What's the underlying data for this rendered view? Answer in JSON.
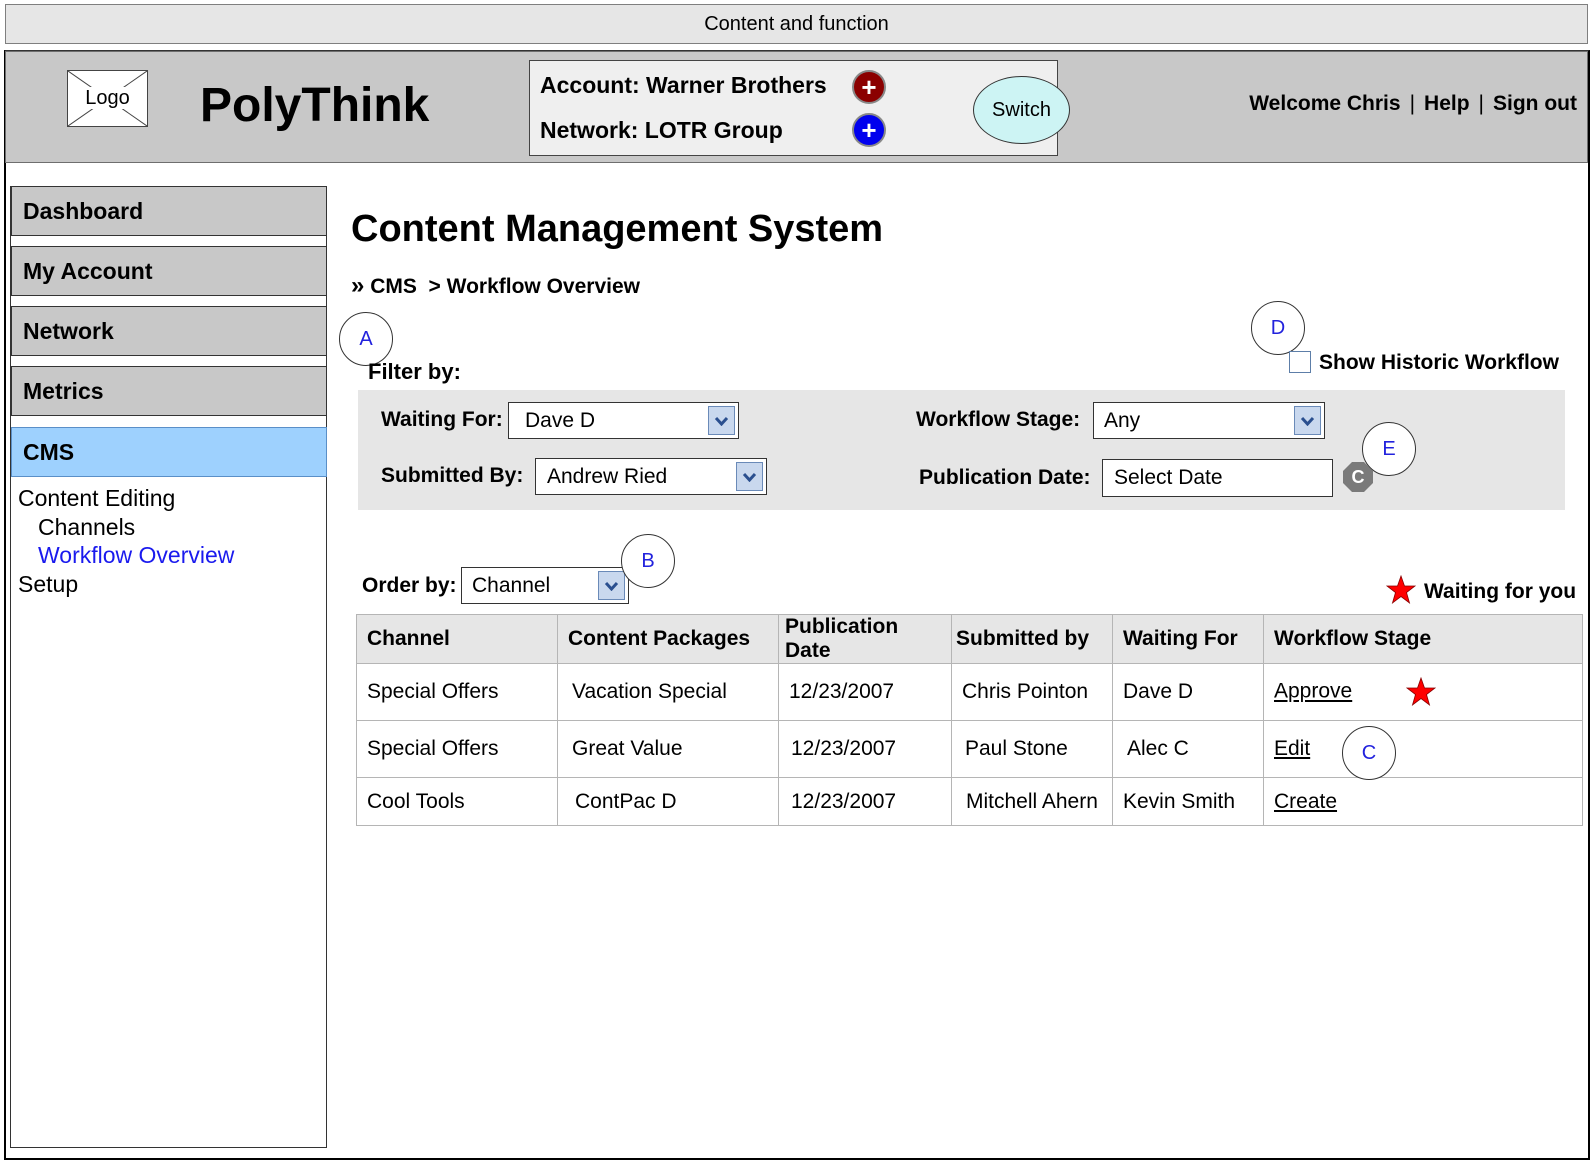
{
  "topbar": {
    "title": "Content and function"
  },
  "header": {
    "logo_text": "Logo",
    "brand": "PolyThink",
    "account_line": "Account: Warner Brothers",
    "network_line": "Network: LOTR Group",
    "account_icon": "plus-icon",
    "network_icon": "plus-icon",
    "account_color": "#8b0000",
    "network_color": "#0000ee",
    "switch_label": "Switch",
    "welcome": "Welcome Chris",
    "help": "Help",
    "signout": "Sign out",
    "separator": "|"
  },
  "sidebar": {
    "items": [
      {
        "label": "Dashboard"
      },
      {
        "label": "My Account"
      },
      {
        "label": "Network"
      },
      {
        "label": "Metrics"
      },
      {
        "label": "CMS",
        "active": true
      }
    ],
    "subnav": {
      "content_editing": "Content Editing",
      "channels": "Channels",
      "workflow_overview": "Workflow Overview",
      "setup": "Setup"
    }
  },
  "main": {
    "title": "Content Management System",
    "breadcrumb_marker": "»",
    "breadcrumb": "CMS  > Workflow Overview",
    "filter_heading": "Filter by:",
    "show_historic": {
      "label": "Show Historic Workflow",
      "checked": false
    },
    "filters": {
      "waiting_for": {
        "label": "Waiting For:",
        "value": "Dave D"
      },
      "workflow_stage": {
        "label": "Workflow Stage:",
        "value": "Any"
      },
      "submitted_by": {
        "label": "Submitted By:",
        "value": "Andrew Ried"
      },
      "publication_date": {
        "label": "Publication Date:",
        "value": "Select Date",
        "clear": "C"
      }
    },
    "order_by": {
      "label": "Order by:",
      "value": "Channel"
    },
    "legend": {
      "label": "Waiting for you",
      "icon": "star-icon",
      "color": "#ff0000"
    },
    "table": {
      "headers": [
        "Channel",
        "Content Packages",
        "Publication Date",
        "Submitted by",
        "Waiting For",
        "Workflow Stage"
      ],
      "rows": [
        {
          "channel": "Special Offers",
          "package": "Vacation Special",
          "date": "12/23/2007",
          "submitted": "Chris Pointon",
          "waiting": "Dave D",
          "stage": "Approve",
          "waiting_for_you": true
        },
        {
          "channel": "Special Offers",
          "package": "Great Value",
          "date": "12/23/2007",
          "submitted": "Paul Stone",
          "waiting": "Alec C",
          "stage": "Edit"
        },
        {
          "channel": "Cool Tools",
          "package": "ContPac D",
          "date": "12/23/2007",
          "submitted": "Mitchell Ahern",
          "waiting": "Kevin Smith",
          "stage": "Create"
        }
      ]
    },
    "callouts": {
      "a": "A",
      "b": "B",
      "c": "C",
      "d": "D",
      "e": "E"
    }
  }
}
